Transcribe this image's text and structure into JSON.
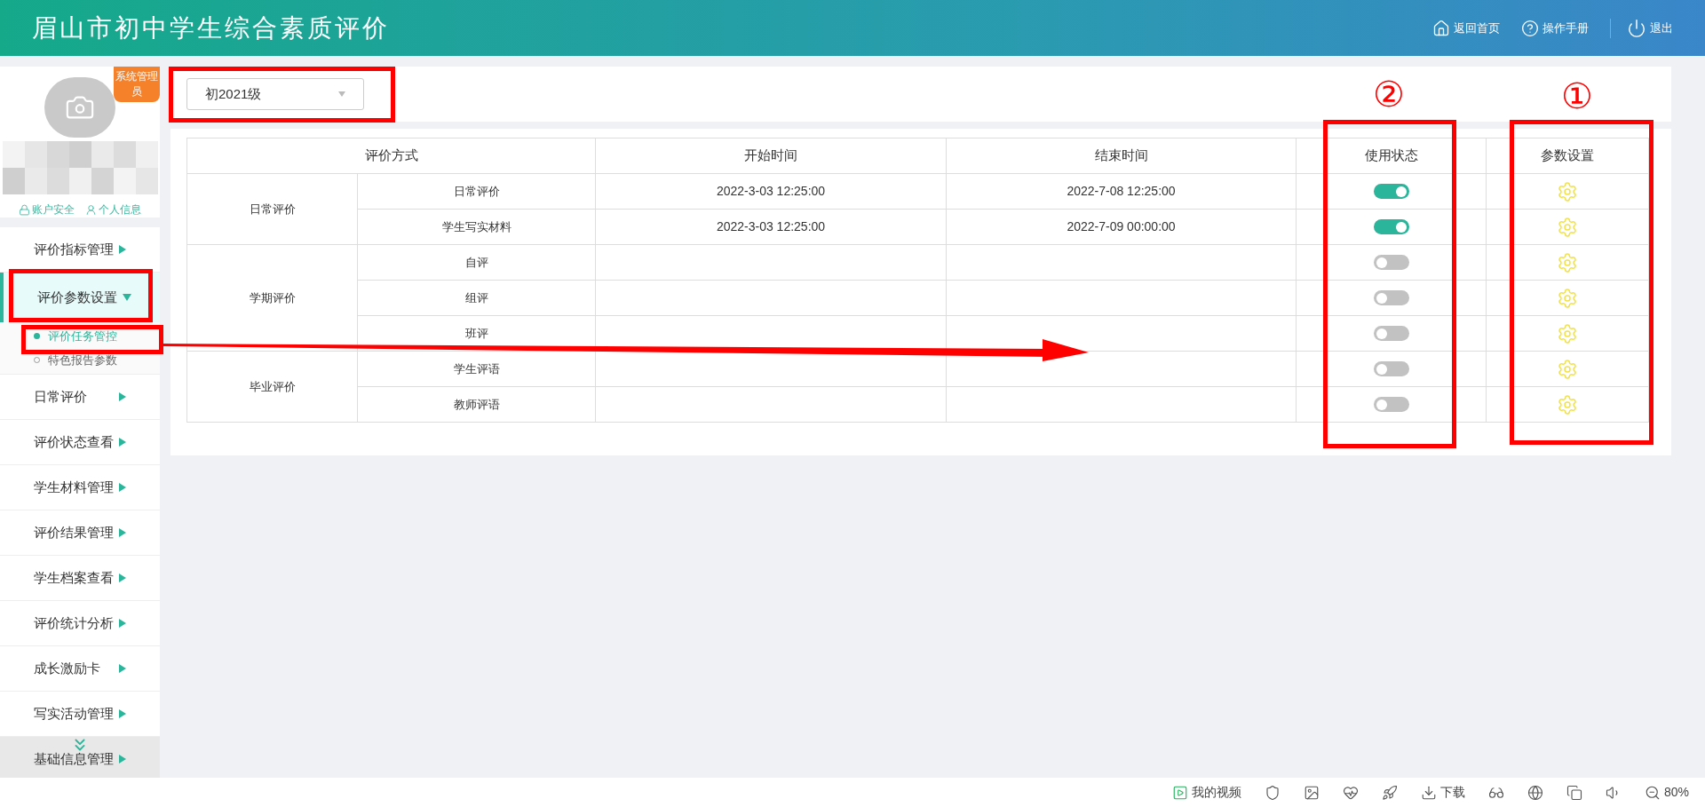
{
  "header": {
    "title": "眉山市初中学生综合素质评价",
    "links": [
      {
        "kind": "home",
        "label": "返回首页"
      },
      {
        "kind": "help",
        "label": "操作手册"
      },
      {
        "kind": "power",
        "label": "退出"
      }
    ]
  },
  "profile": {
    "badge": "系统管理员",
    "links": [
      {
        "kind": "lock",
        "label": "账户安全"
      },
      {
        "kind": "user",
        "label": "个人信息"
      }
    ]
  },
  "menu": [
    {
      "label": "评价指标管理",
      "expanded": false
    },
    {
      "label": "评价参数设置",
      "expanded": true,
      "children": [
        {
          "label": "评价任务管控",
          "selected": true
        },
        {
          "label": "特色报告参数",
          "selected": false
        }
      ]
    },
    {
      "label": "日常评价",
      "expanded": false
    },
    {
      "label": "评价状态查看",
      "expanded": false
    },
    {
      "label": "学生材料管理",
      "expanded": false
    },
    {
      "label": "评价结果管理",
      "expanded": false
    },
    {
      "label": "学生档案查看",
      "expanded": false
    },
    {
      "label": "评价统计分析",
      "expanded": false
    },
    {
      "label": "成长激励卡",
      "expanded": false
    },
    {
      "label": "写实活动管理",
      "expanded": false
    },
    {
      "label": "基础信息管理",
      "expanded": false
    }
  ],
  "grade_select": {
    "value": "初2021级"
  },
  "table": {
    "columns": [
      "评价方式",
      "开始时间",
      "结束时间",
      "使用状态",
      "参数设置"
    ],
    "groups": [
      {
        "name": "日常评价",
        "rows": [
          {
            "method": "日常评价",
            "start": "2022-3-03 12:25:00",
            "end": "2022-7-08 12:25:00",
            "on": true
          },
          {
            "method": "学生写实材料",
            "start": "2022-3-03 12:25:00",
            "end": "2022-7-09 00:00:00",
            "on": true
          }
        ]
      },
      {
        "name": "学期评价",
        "rows": [
          {
            "method": "自评",
            "on": false
          },
          {
            "method": "组评",
            "on": false
          },
          {
            "method": "班评",
            "on": false
          }
        ]
      },
      {
        "name": "毕业评价",
        "rows": [
          {
            "method": "学生评语",
            "on": false
          },
          {
            "method": "教师评语",
            "on": false
          }
        ]
      }
    ]
  },
  "annotations": {
    "markers": [
      "②",
      "①"
    ]
  },
  "status_bar": [
    {
      "kind": "video",
      "label": "我的视频"
    },
    {
      "kind": "shield"
    },
    {
      "kind": "image"
    },
    {
      "kind": "heart"
    },
    {
      "kind": "rocket"
    },
    {
      "kind": "download",
      "label": "下载"
    },
    {
      "kind": "glasses"
    },
    {
      "kind": "globe"
    },
    {
      "kind": "copy"
    },
    {
      "kind": "volume"
    },
    {
      "kind": "zoom",
      "label": "80%"
    }
  ]
}
